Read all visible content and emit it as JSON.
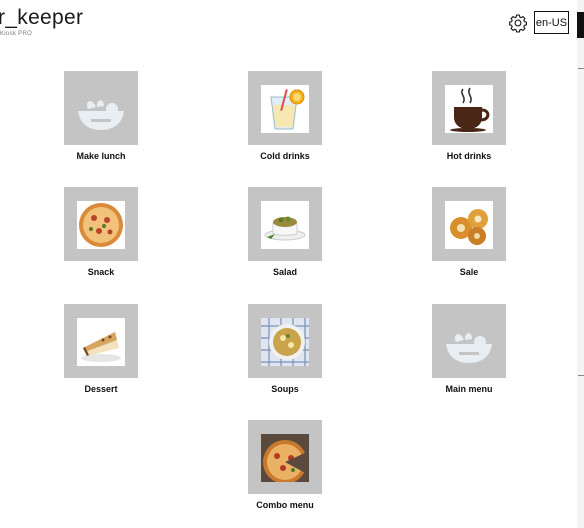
{
  "header": {
    "title": "r_keeper",
    "subtitle": "Kiosk PRO",
    "language": "en-US",
    "settings_icon": "gear-icon"
  },
  "menu": {
    "items": [
      {
        "label": "Make lunch",
        "icon": "bowl-logo-icon"
      },
      {
        "label": "Cold drinks",
        "icon": "cold-drink-icon"
      },
      {
        "label": "Hot drinks",
        "icon": "coffee-cup-icon"
      },
      {
        "label": "Snack",
        "icon": "pizza-icon"
      },
      {
        "label": "Salad",
        "icon": "salad-icon"
      },
      {
        "label": "Sale",
        "icon": "pastry-icon"
      },
      {
        "label": "Dessert",
        "icon": "cake-icon"
      },
      {
        "label": "Soups",
        "icon": "soup-icon"
      },
      {
        "label": "Main menu",
        "icon": "bowl-logo-icon"
      },
      {
        "label": "Combo menu",
        "icon": "combo-pizza-icon"
      }
    ]
  },
  "colors": {
    "tile_background": "#c4c4c4",
    "logo_color": "#e9eef2"
  }
}
